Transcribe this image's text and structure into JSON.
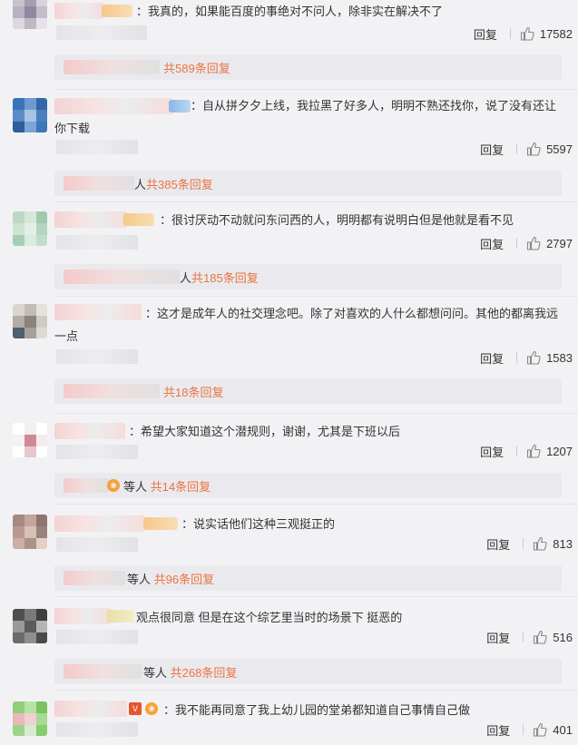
{
  "comments": [
    {
      "text": "：我真的，如果能百度的事绝对不问人，除非实在解决不了",
      "reply_label": "回复",
      "likes": "17582",
      "more_replies": "共589条回复",
      "more_prefix": ""
    },
    {
      "text": "：自从拼夕夕上线，我拉黑了好多人，明明不熟还找你，说了没有还让你下载",
      "reply_label": "回复",
      "likes": "5597",
      "more_replies": "共385条回复",
      "more_prefix": "人"
    },
    {
      "text": "：很讨厌动不动就问东问西的人，明明都有说明白但是他就是看不见",
      "reply_label": "回复",
      "likes": "2797",
      "more_replies": "共185条回复",
      "more_prefix": "人"
    },
    {
      "text": "：这才是成年人的社交理念吧。除了对喜欢的人什么都想问问。其他的都离我远一点",
      "reply_label": "回复",
      "likes": "1583",
      "more_replies": "共18条回复",
      "more_prefix": ""
    },
    {
      "text": "：希望大家知道这个潜规则，谢谢，尤其是下班以后",
      "reply_label": "回复",
      "likes": "1207",
      "more_replies": "共14条回复",
      "more_prefix": "等人"
    },
    {
      "text": "：说实话他们这种三观挺正的",
      "reply_label": "回复",
      "likes": "813",
      "more_replies": "共96条回复",
      "more_prefix": "等人"
    },
    {
      "text": "观点很同意 但是在这个综艺里当时的场景下 挺恶的",
      "reply_label": "回复",
      "likes": "516",
      "more_replies": "共268条回复",
      "more_prefix": "等人"
    },
    {
      "text": "：我不能再同意了我上幼儿园的堂弟都知道自己事情自己做",
      "reply_label": "回复",
      "likes": "401",
      "more_replies": "",
      "more_prefix": ""
    }
  ],
  "colors": {
    "accent": "#eb7340",
    "background": "#f2f2f5",
    "text": "#333333"
  },
  "icons": {
    "like": "thumbs-up-icon"
  }
}
